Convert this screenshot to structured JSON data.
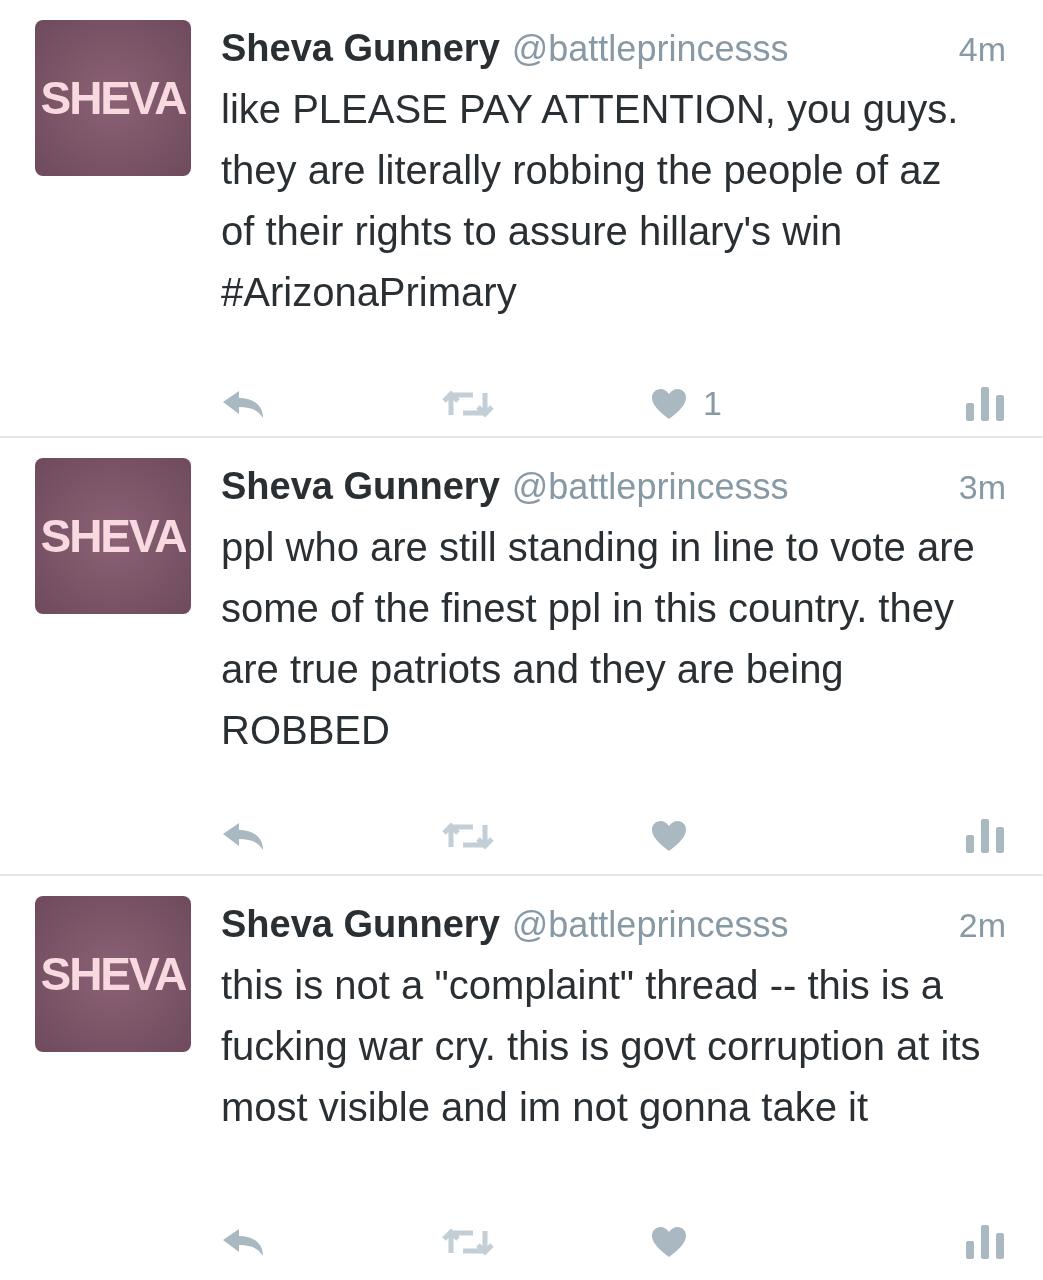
{
  "tweets": [
    {
      "avatar_text": "SHEVA",
      "name": "Sheva Gunnery",
      "handle": "@battleprincesss",
      "time": "4m",
      "text": "like PLEASE PAY ATTENTION, you guys. they are literally robbing the people of az of their rights to assure hillary's win #ArizonaPrimary",
      "like_count": "1"
    },
    {
      "avatar_text": "SHEVA",
      "name": "Sheva Gunnery",
      "handle": "@battleprincesss",
      "time": "3m",
      "text": "ppl who are still standing in line to vote are some of the finest ppl in this country. they are true patriots and they are being ROBBED"
    },
    {
      "avatar_text": "SHEVA",
      "name": "Sheva Gunnery",
      "handle": "@battleprincesss",
      "time": "2m",
      "text": "this is not a \"complaint\" thread -- this is a fucking war cry. this is govt corruption at its most visible and im not gonna take it"
    }
  ]
}
